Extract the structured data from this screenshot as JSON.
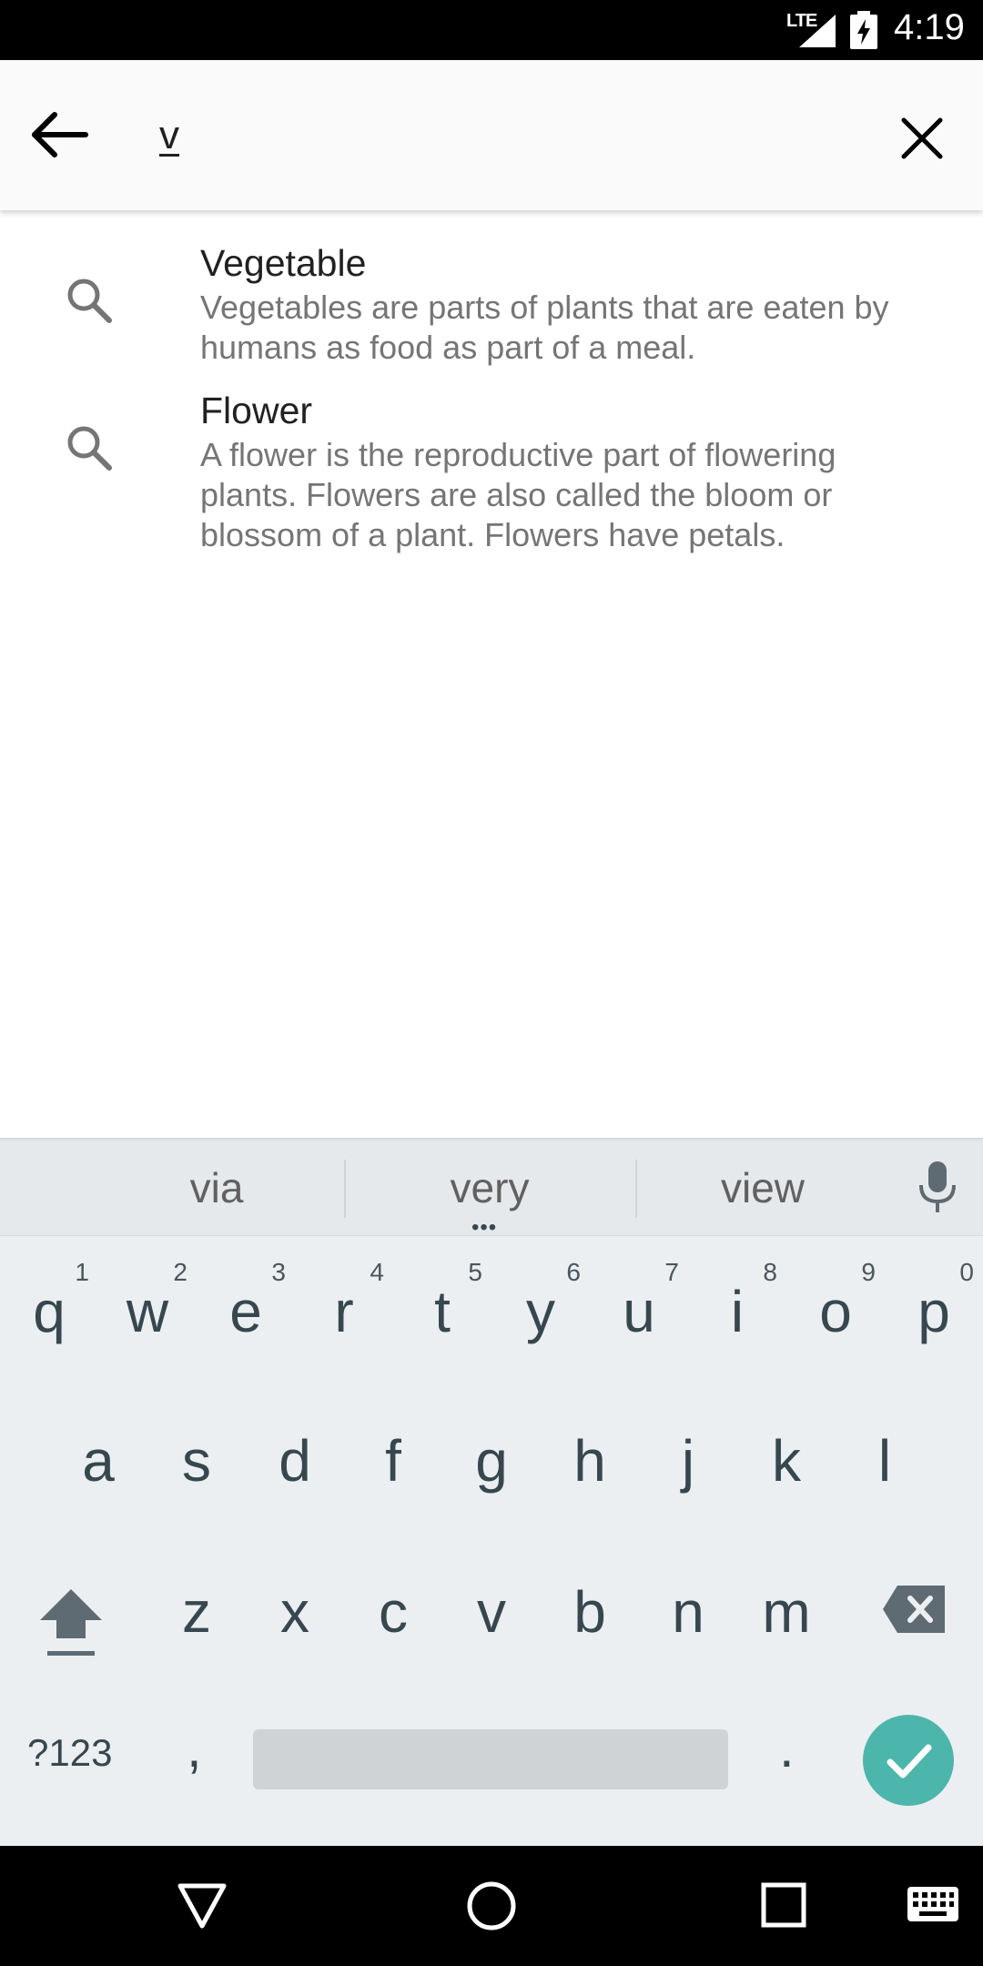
{
  "status_bar": {
    "network": "LTE",
    "time": "4:19"
  },
  "search": {
    "query": "v"
  },
  "suggestions": [
    {
      "title": "Vegetable",
      "description": "Vegetables are parts of plants that are eaten by humans as food as part of a meal.",
      "icon": "search-icon"
    },
    {
      "title": "Flower",
      "description": "A flower is the reproductive part of flowering plants. Flowers are also called the bloom or blossom of a plant. Flowers have petals.",
      "icon": "search-icon"
    }
  ],
  "keyboard": {
    "word_suggestions": [
      "via",
      "very",
      "view"
    ],
    "more_indicator": "•••",
    "row1": [
      {
        "key": "q",
        "hint": "1"
      },
      {
        "key": "w",
        "hint": "2"
      },
      {
        "key": "e",
        "hint": "3"
      },
      {
        "key": "r",
        "hint": "4"
      },
      {
        "key": "t",
        "hint": "5"
      },
      {
        "key": "y",
        "hint": "6"
      },
      {
        "key": "u",
        "hint": "7"
      },
      {
        "key": "i",
        "hint": "8"
      },
      {
        "key": "o",
        "hint": "9"
      },
      {
        "key": "p",
        "hint": "0"
      }
    ],
    "row2": [
      "a",
      "s",
      "d",
      "f",
      "g",
      "h",
      "j",
      "k",
      "l"
    ],
    "row3": [
      "z",
      "x",
      "c",
      "v",
      "b",
      "n",
      "m"
    ],
    "symbols_label": "?123",
    "comma": ",",
    "period": ".",
    "enter_color": "#4db6ac"
  }
}
